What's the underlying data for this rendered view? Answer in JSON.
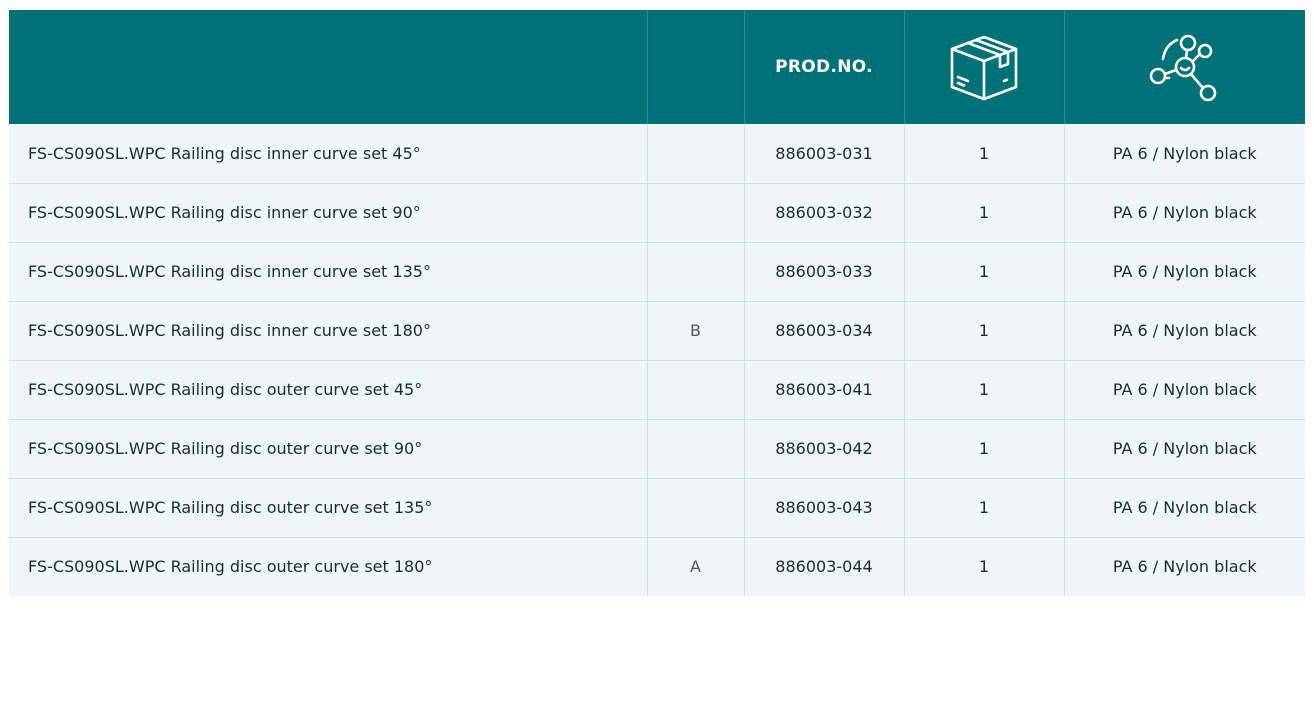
{
  "table": {
    "header": {
      "name": "",
      "position": "",
      "prod_no": "PROD.NO.",
      "pack_icon": "package-box-icon",
      "material_icon": "molecule-network-icon"
    },
    "rows": [
      {
        "name": "FS-CS090SL.WPC Railing disc inner curve set 45°",
        "position": "",
        "prod_no": "886003-031",
        "pack_qty": "1",
        "material": "PA 6 / Nylon black"
      },
      {
        "name": "FS-CS090SL.WPC Railing disc inner curve set 90°",
        "position": "",
        "prod_no": "886003-032",
        "pack_qty": "1",
        "material": "PA 6 / Nylon black"
      },
      {
        "name": "FS-CS090SL.WPC Railing disc inner curve set 135°",
        "position": "",
        "prod_no": "886003-033",
        "pack_qty": "1",
        "material": "PA 6 / Nylon black"
      },
      {
        "name": "FS-CS090SL.WPC Railing disc inner curve set 180°",
        "position": "B",
        "prod_no": "886003-034",
        "pack_qty": "1",
        "material": "PA 6 / Nylon black"
      },
      {
        "name": "FS-CS090SL.WPC Railing disc outer curve set 45°",
        "position": "",
        "prod_no": "886003-041",
        "pack_qty": "1",
        "material": "PA 6 / Nylon black"
      },
      {
        "name": "FS-CS090SL.WPC Railing disc outer curve set 90°",
        "position": "",
        "prod_no": "886003-042",
        "pack_qty": "1",
        "material": "PA 6 / Nylon black"
      },
      {
        "name": "FS-CS090SL.WPC Railing disc outer curve set 135°",
        "position": "",
        "prod_no": "886003-043",
        "pack_qty": "1",
        "material": "PA 6 / Nylon black"
      },
      {
        "name": "FS-CS090SL.WPC Railing disc outer curve set 180°",
        "position": "A",
        "prod_no": "886003-044",
        "pack_qty": "1",
        "material": "PA 6 / Nylon black"
      }
    ]
  },
  "colors": {
    "header_bg": "#007176",
    "row_bg": "#eef6f7",
    "grid_line": "#cfe3e5",
    "text": "#1e2a30"
  }
}
